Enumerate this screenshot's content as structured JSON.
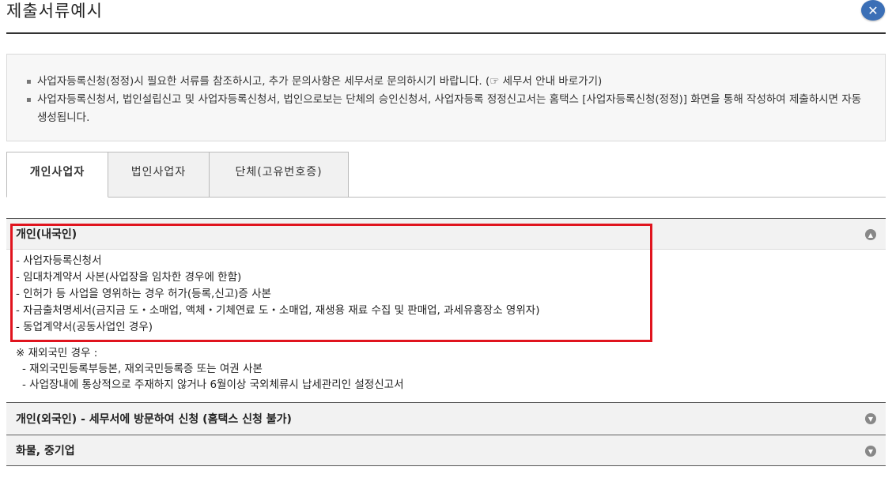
{
  "title": "제출서류예시",
  "close_symbol": "✕",
  "notice": {
    "items": [
      {
        "text": "사업자등록신청(정정)시 필요한 서류를 참조하시고, 추가 문의사항은 세무서로 문의하시기 바랍니다. (",
        "link": "☞ 세무서 안내 바로가기",
        "tail": ")"
      },
      {
        "text": "사업자등록신청서, 법인설립신고 및 사업자등록신청서, 법인으로보는 단체의 승인신청서, 사업자등록 정정신고서는 홈택스 [사업자등록신청(정정)] 화면을 통해 작성하여 제출하시면 자동 생성됩니다."
      }
    ]
  },
  "tabs": [
    "개인사업자",
    "법인사업자",
    "단체(고유번호증)"
  ],
  "sections": [
    {
      "heading": "개인(내국인)",
      "requirements": [
        "- 사업자등록신청서",
        "- 임대차계약서 사본(사업장을 임차한 경우에 한함)",
        "- 인허가 등 사업을 영위하는 경우 허가(등록,신고)증 사본",
        "- 자금출처명세서(금지금 도・소매업, 액체・기체연료 도・소매업, 재생용 재료 수집 및 판매업, 과세유흥장소 영위자)",
        "- 동업계약서(공동사업인 경우)"
      ],
      "note_title": "※ 재외국민 경우 :",
      "note_items": [
        "- 재외국민등록부등본, 재외국민등록증 또는 여권 사본",
        "- 사업장내에 통상적으로 주재하지 않거나 6월이상 국외체류시 납세관리인 설정신고서"
      ]
    },
    {
      "heading": "개인(외국인) - 세무서에 방문하여 신청 (홈택스 신청 불가)"
    },
    {
      "heading": "화물, 중기업"
    }
  ],
  "colors": {
    "highlight": "#e0141e",
    "close_button": "#3b6fb6"
  }
}
